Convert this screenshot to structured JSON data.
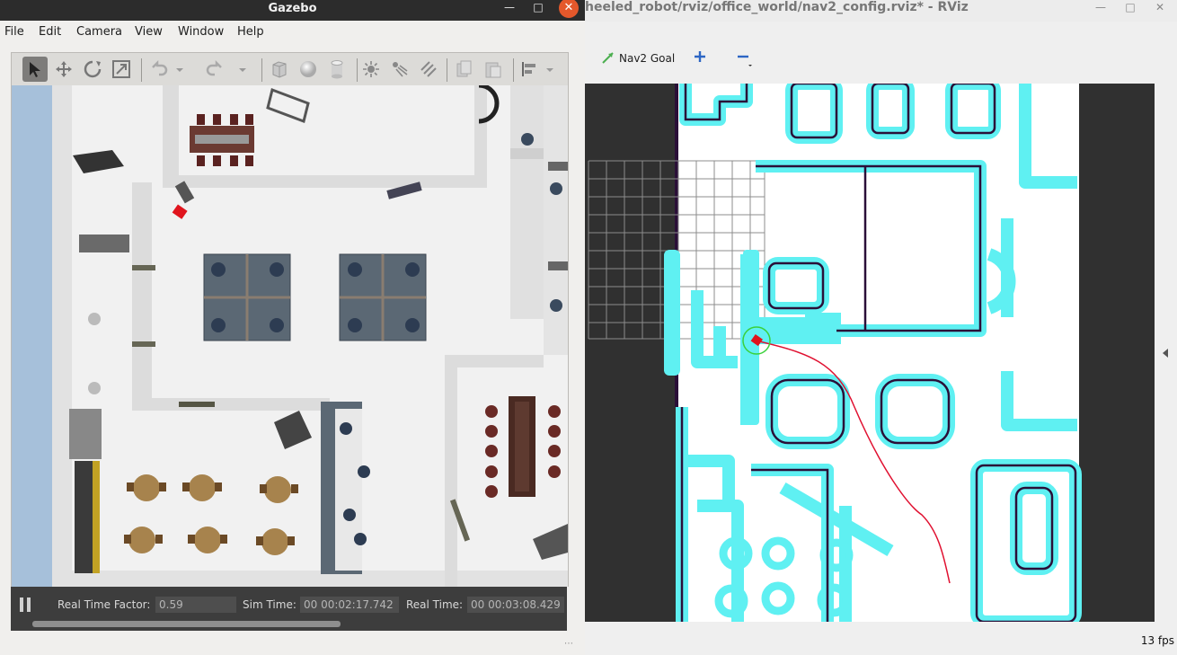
{
  "gazebo": {
    "title": "Gazebo",
    "menu": [
      "File",
      "Edit",
      "Camera",
      "View",
      "Window",
      "Help"
    ],
    "toolbar_icons": [
      "select-arrow-icon",
      "translate-icon",
      "rotate-icon",
      "scale-icon",
      "undo-icon",
      "undo-dropdown-icon",
      "redo-icon",
      "redo-dropdown-icon",
      "box-shape-icon",
      "sphere-shape-icon",
      "cylinder-shape-icon",
      "point-light-icon",
      "spot-light-icon",
      "directional-light-icon",
      "copy-icon",
      "paste-icon",
      "align-icon",
      "snap-icon"
    ],
    "status": {
      "real_time_factor_label": "Real Time Factor:",
      "real_time_factor": "0.59",
      "sim_time_label": "Sim Time:",
      "sim_time": "00 00:02:17.742",
      "real_time_label": "Real Time:",
      "real_time": "00 00:03:08.429"
    },
    "colors": {
      "robot": "#e0141d",
      "floor": "#f1f1f1",
      "desk_blue": "#4a5561",
      "wood": "#9a7b4b"
    }
  },
  "rviz": {
    "title": "heeled_robot/rviz/office_world/nav2_config.rviz* - RViz",
    "toolbar": {
      "nav2_goal_label": "Nav2 Goal",
      "add_tool_icon": "plus-icon",
      "remove_tool_icon": "minus-icon"
    },
    "fps": "13 fps",
    "colors": {
      "costmap": "#5ff0f2",
      "wall": "#2a0f38",
      "path": "#e01030",
      "robot": "#e0141d",
      "goal_circle": "#3ad13a"
    }
  }
}
